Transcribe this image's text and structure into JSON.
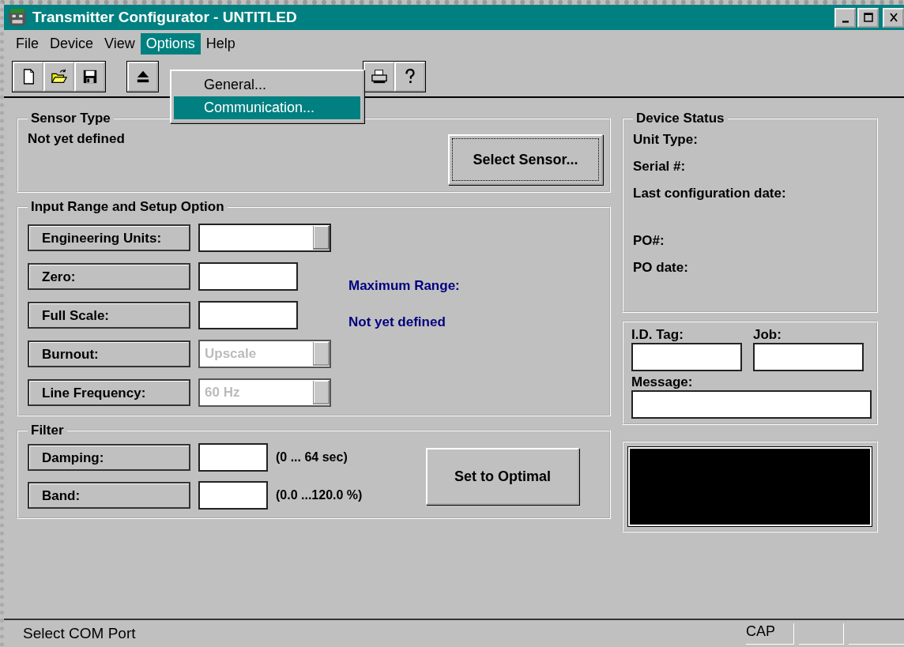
{
  "window": {
    "title": "Transmitter Configurator - UNTITLED"
  },
  "menu": [
    {
      "label": "File",
      "selected": false
    },
    {
      "label": "Device",
      "selected": false
    },
    {
      "label": "View",
      "selected": false
    },
    {
      "label": "Options",
      "selected": true
    },
    {
      "label": "Help",
      "selected": false
    }
  ],
  "open_menu": {
    "items": [
      {
        "label": "General...",
        "selected": false
      },
      {
        "label": "Communication...",
        "selected": true
      }
    ]
  },
  "toolbar": {
    "groups": [
      {
        "buttons": [
          {
            "kind": "new"
          },
          {
            "kind": "open"
          },
          {
            "kind": "save"
          }
        ]
      },
      {
        "buttons": [
          {
            "kind": "eject"
          }
        ]
      },
      {
        "buttons": [
          {
            "kind": "print"
          },
          {
            "kind": "help"
          }
        ]
      }
    ]
  },
  "sensor_type": {
    "title": "Sensor Type",
    "value": "Not yet defined",
    "button": {
      "label": "Select Sensor...",
      "focused": true
    }
  },
  "input_range": {
    "title": "Input Range and Setup Option",
    "rows": [
      {
        "label": "Engineering Units:",
        "kind": "dropdown",
        "disabled": false
      },
      {
        "label": "Zero:",
        "kind": "text"
      },
      {
        "label": "Full Scale:",
        "kind": "text"
      },
      {
        "label": "Burnout:",
        "kind": "dropdown",
        "disabled": true,
        "value": "Upscale"
      },
      {
        "label": "Line Frequency:",
        "kind": "dropdown",
        "disabled": true,
        "value": "60 Hz"
      }
    ],
    "max_range": {
      "label": "Maximum Range:",
      "value": "Not yet defined"
    }
  },
  "filter": {
    "title": "Filter",
    "rows": [
      {
        "label": "Damping:",
        "hint": "(0 ... 64 sec)"
      },
      {
        "label": "Band:",
        "hint": "(0.0 ...120.0 %)"
      }
    ],
    "button": {
      "label": "Set to Optimal",
      "focused": false
    }
  },
  "device_status": {
    "title": "Device Status",
    "fields": [
      "Unit Type:",
      "Serial #:",
      "Last configuration date:",
      "PO#:",
      "PO date:"
    ]
  },
  "tags": {
    "id_tag": "I.D. Tag:",
    "job": "Job:",
    "message": "Message:"
  },
  "status_bar": {
    "text": "Select COM Port",
    "indicators": [
      "CAP"
    ]
  }
}
